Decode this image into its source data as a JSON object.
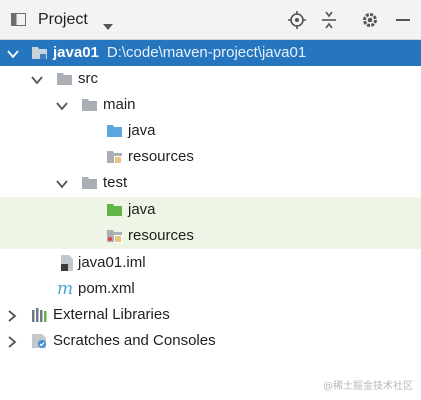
{
  "panel": {
    "title": "Project",
    "toolbar_icons": [
      "locate-icon",
      "collapse-all-icon",
      "gear-icon",
      "minimize-icon"
    ]
  },
  "tree": {
    "root": {
      "name": "java01",
      "path": "D:\\code\\maven-project\\java01"
    },
    "src": "src",
    "main": "main",
    "main_java": "java",
    "main_resources": "resources",
    "test": "test",
    "test_java": "java",
    "test_resources": "resources",
    "iml": "java01.iml",
    "pom": "pom.xml",
    "external_libraries": "External Libraries",
    "scratches": "Scratches and Consoles"
  },
  "colors": {
    "selection": "#2675bf",
    "test_highlight": "#eef5e6",
    "source_folder": "#5aa7e0",
    "test_folder": "#62b543",
    "folder": "#a9afb5",
    "maven": "#4aa3d6"
  },
  "watermark": "@稀土掘金技术社区"
}
